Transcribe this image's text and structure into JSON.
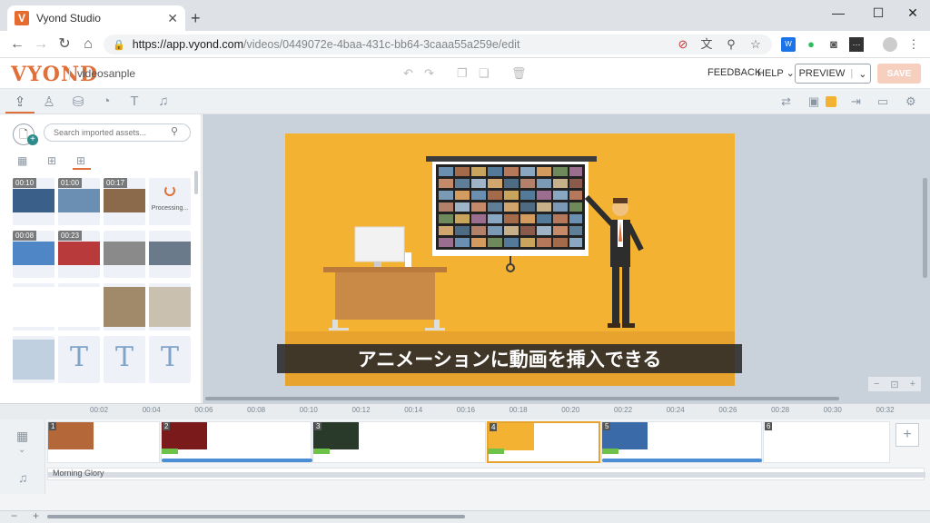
{
  "browser": {
    "tab_title": "Vyond Studio",
    "favicon_letter": "V",
    "url_host": "https://app.vyond.com",
    "url_path": "/videos/0449072e-4baa-431c-bb64-3caaa55a259e/edit"
  },
  "app": {
    "logo": "VYOND",
    "video_name": "videosanple",
    "feedback_label": "FEEDBACK",
    "help_label": "HELP ⌄",
    "preview_label": "PREVIEW",
    "preview_caret": "⌄",
    "save_label": "SAVE",
    "accent_color": "#e0703a"
  },
  "library": {
    "search_placeholder": "Search imported assets...",
    "thumbnails": [
      {
        "duration": "00:10",
        "kind": "video"
      },
      {
        "duration": "01:00",
        "kind": "video"
      },
      {
        "duration": "00:17",
        "kind": "video"
      },
      {
        "status": "Processing...",
        "kind": "processing"
      },
      {
        "duration": "00:08",
        "kind": "video"
      },
      {
        "duration": "00:23",
        "kind": "video"
      },
      {
        "duration": "",
        "kind": "image"
      },
      {
        "duration": "",
        "kind": "image"
      },
      {
        "duration": "",
        "kind": "image"
      },
      {
        "duration": "",
        "kind": "image"
      },
      {
        "duration": "",
        "kind": "image"
      },
      {
        "duration": "",
        "kind": "image"
      },
      {
        "duration": "",
        "kind": "image"
      },
      {
        "text": "T",
        "kind": "text"
      },
      {
        "text": "T",
        "kind": "text"
      },
      {
        "text": "T",
        "kind": "text"
      }
    ]
  },
  "stage": {
    "caption": "アニメーションに動画を挿入できる",
    "background_color": "#f4b233"
  },
  "timeline": {
    "ticks": [
      "00:02",
      "00:04",
      "00:06",
      "00:08",
      "00:10",
      "00:12",
      "00:14",
      "00:16",
      "00:18",
      "00:20",
      "00:22",
      "00:24",
      "00:26",
      "00:28",
      "00:30",
      "00:32"
    ],
    "scenes": [
      "1",
      "2",
      "3",
      "4",
      "5",
      "6"
    ],
    "audio_track_name": "Morning Glory"
  }
}
